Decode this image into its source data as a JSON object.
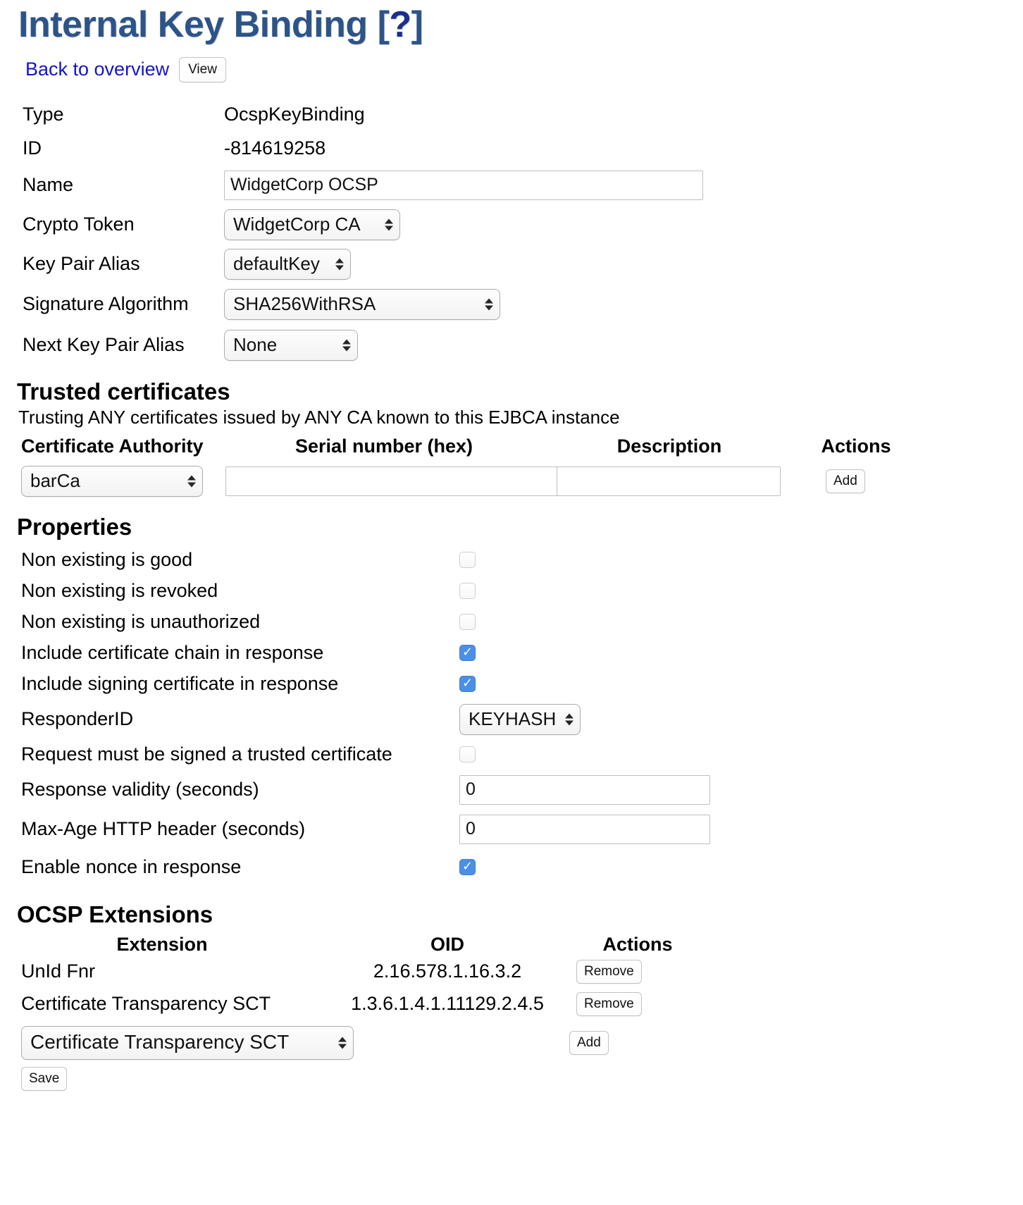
{
  "header": {
    "title_main": "Internal Key Binding ",
    "title_bracket_open": "[",
    "title_help": "?",
    "title_bracket_close": "]",
    "back_link": "Back to overview",
    "view_button": "View"
  },
  "fields": [
    {
      "label": "Type",
      "kind": "text",
      "value": "OcspKeyBinding"
    },
    {
      "label": "ID",
      "kind": "text",
      "value": "-814619258"
    },
    {
      "label": "Name",
      "kind": "input",
      "value": "WidgetCorp OCSP",
      "placeholder": ""
    },
    {
      "label": "Crypto Token",
      "kind": "select",
      "value": "WidgetCorp CA"
    },
    {
      "label": "Key Pair Alias",
      "kind": "select",
      "value": "defaultKey"
    },
    {
      "label": "Signature Algorithm",
      "kind": "select",
      "value": "SHA256WithRSA"
    },
    {
      "label": "Next Key Pair Alias",
      "kind": "select",
      "value": "None"
    }
  ],
  "trusted": {
    "heading": "Trusted certificates",
    "note": "Trusting ANY certificates issued by ANY CA known to this EJBCA instance",
    "columns": [
      "Certificate Authority",
      "Serial number (hex)",
      "Description",
      "Actions"
    ],
    "row": {
      "ca_value": "barCa",
      "serial_value": "",
      "serial_placeholder": "",
      "description_value": "",
      "description_placeholder": "",
      "add_label": "Add"
    }
  },
  "properties": {
    "heading": "Properties",
    "items": [
      {
        "label": "Non existing is good",
        "type": "checkbox",
        "checked": false
      },
      {
        "label": "Non existing is revoked",
        "type": "checkbox",
        "checked": false
      },
      {
        "label": "Non existing is unauthorized",
        "type": "checkbox",
        "checked": false
      },
      {
        "label": "Include certificate chain in response",
        "type": "checkbox",
        "checked": true
      },
      {
        "label": "Include signing certificate in response",
        "type": "checkbox",
        "checked": true
      },
      {
        "label": "ResponderID",
        "type": "select",
        "value": "KEYHASH"
      },
      {
        "label": "Request must be signed a trusted certificate",
        "type": "checkbox",
        "checked": false
      },
      {
        "label": "Response validity (seconds)",
        "type": "input",
        "value": "0"
      },
      {
        "label": "Max-Age HTTP header (seconds)",
        "type": "input",
        "value": "0"
      },
      {
        "label": "Enable nonce in response",
        "type": "checkbox",
        "checked": true
      }
    ]
  },
  "extensions": {
    "heading": "OCSP Extensions",
    "columns": [
      "Extension",
      "OID",
      "Actions"
    ],
    "rows": [
      {
        "name": "UnId Fnr",
        "oid": "2.16.578.1.16.3.2",
        "action": "Remove"
      },
      {
        "name": "Certificate Transparency SCT",
        "oid": "1.3.6.1.4.1.11129.2.4.5",
        "action": "Remove"
      }
    ],
    "add_select_value": "Certificate Transparency SCT",
    "add_label": "Add"
  },
  "footer": {
    "save_label": "Save"
  },
  "colors": {
    "title": "#2d5488",
    "help": "#1a2f8f",
    "link": "#1414cc",
    "checkbox_on": "#4a90e8"
  }
}
